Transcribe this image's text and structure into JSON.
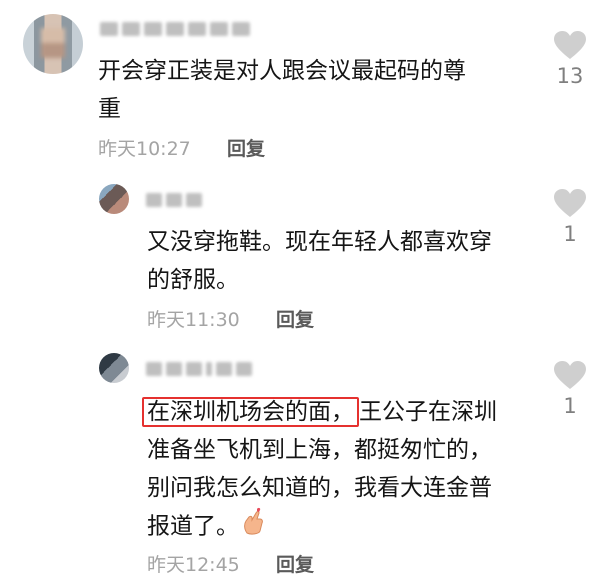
{
  "comments": [
    {
      "text": "开会穿正装是对人跟会议最起码的尊重",
      "line1": "开会穿正装是对人跟会议最起码的尊",
      "line2": "重",
      "time": "昨天10:27",
      "reply_label": "回复",
      "likes": "13"
    }
  ],
  "replies": [
    {
      "line1": "又没穿拖鞋。现在年轻人都喜欢穿",
      "line2": "的舒服。",
      "time": "昨天11:30",
      "reply_label": "回复",
      "likes": "1"
    },
    {
      "highlight": "在深圳机场会的面，",
      "line1_rest": "王公子在深圳",
      "line2": "准备坐飞机到上海，都挺匆忙的，",
      "line3": "别问我怎么知道的，我看大连金普",
      "line4": "报道了。",
      "emoji": "finger-heart-emoji",
      "time": "昨天12:45",
      "reply_label": "回复",
      "likes": "1"
    }
  ],
  "colors": {
    "highlight_border": "#e5312f",
    "like_icon": "#cfcfcf",
    "meta_text": "#a4a4a4"
  }
}
